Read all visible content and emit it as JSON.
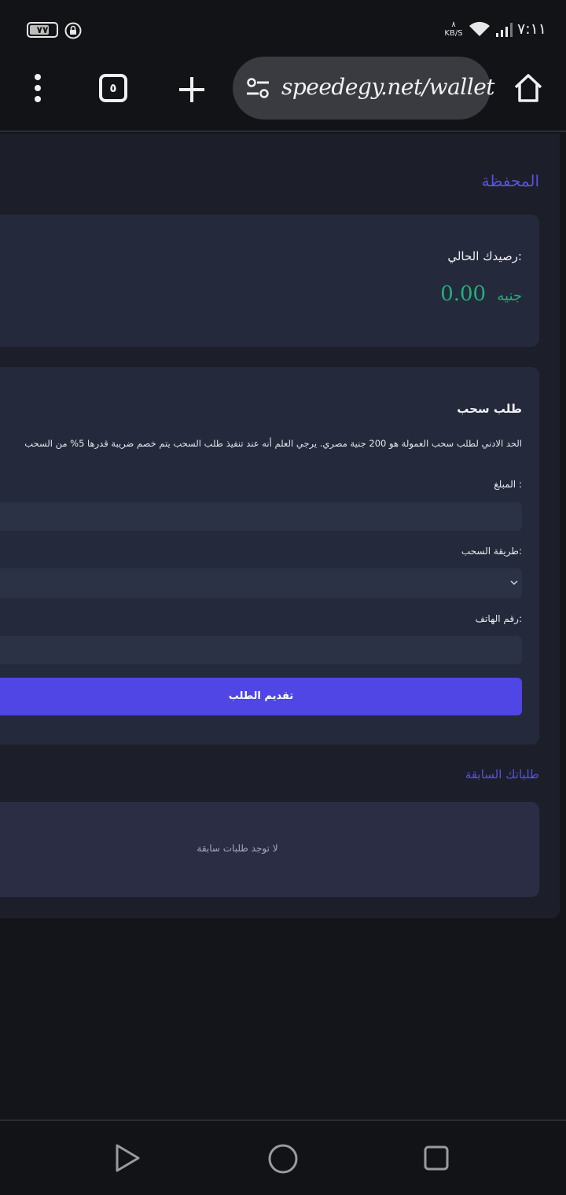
{
  "status_bar": {
    "battery": "٧٧",
    "net_speed_value": "٨",
    "net_speed_unit": "KB/S",
    "time": "٧:١١"
  },
  "browser": {
    "tabs_count": "٥",
    "url": "speedegy.net/wallet"
  },
  "page": {
    "title": "المحفظة",
    "balance": {
      "label": ":رصيدك الحالي",
      "amount": "0.00",
      "currency": "جنيه"
    },
    "withdraw": {
      "title": "طلب سحب",
      "notice": "الحد الادني لطلب سحب العمولة هو 200 جنية مصري. يرجي العلم أنه عند تنفيذ طلب السحب يتم خصم ضريبة قدرها 5% من السحب",
      "amount_label": ": المبلغ",
      "amount_value": "",
      "method_label": ":طريقة السحب",
      "method_value": "",
      "phone_label": ":رقم الهاتف",
      "phone_value": "",
      "submit_label": "تقديم الطلب"
    },
    "history": {
      "title": "طلباتك السابقة",
      "empty_text": "لا توجد طلبات سابقة"
    }
  },
  "colors": {
    "accent": "#4f46e5",
    "heading": "#5b51e2",
    "balance": "#22b07a",
    "card": "#242a3b",
    "page_bg": "#1c1f2a"
  },
  "icons": [
    "lock-icon",
    "wifi-icon",
    "signal-icon",
    "menu-icon",
    "plus-icon",
    "tune-icon",
    "home-icon",
    "chevron-down-icon",
    "back-icon",
    "home-circle-icon",
    "recents-icon"
  ]
}
